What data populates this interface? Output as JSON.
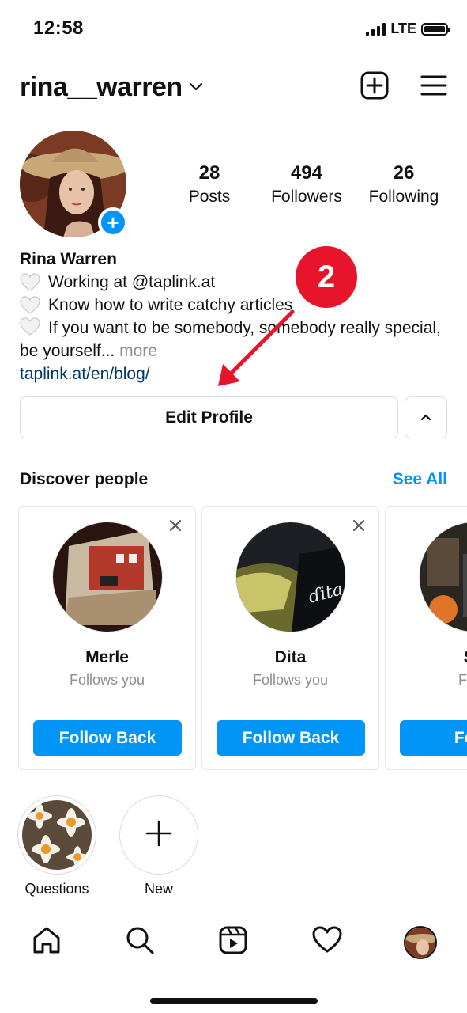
{
  "status_bar": {
    "time": "12:58",
    "network": "LTE",
    "battery_level": 0.95
  },
  "header": {
    "username": "rina__warren",
    "icons": [
      "chevron-down-icon",
      "add-post-icon",
      "menu-icon"
    ]
  },
  "profile": {
    "stats": [
      {
        "value": "28",
        "label": "Posts"
      },
      {
        "value": "494",
        "label": "Followers"
      },
      {
        "value": "26",
        "label": "Following"
      }
    ],
    "name": "Rina Warren",
    "bio_lines": [
      "Working at @taplink.at",
      "Know how to write catchy articles",
      "If you want to be somebody, somebody really special, be yourself..."
    ],
    "more": "more",
    "link": "taplink.at/en/blog/"
  },
  "annotation": {
    "number": "2",
    "color": "#e8142b"
  },
  "buttons": {
    "edit_profile": "Edit Profile"
  },
  "discover": {
    "title": "Discover people",
    "see_all": "See All",
    "cards": [
      {
        "name": "Merle",
        "subtitle": "Follows you",
        "button": "Follow Back"
      },
      {
        "name": "Dita",
        "subtitle": "Follows you",
        "button": "Follow Back"
      },
      {
        "name": "Sy",
        "subtitle": "Follo",
        "button": "Follo"
      }
    ]
  },
  "highlights": [
    {
      "label": "Questions"
    },
    {
      "label": "New"
    }
  ],
  "tabbar": {
    "items": [
      "home-icon",
      "search-icon",
      "reels-icon",
      "heart-icon",
      "profile-avatar"
    ]
  },
  "colors": {
    "accent": "#0095f6",
    "link": "#00376b",
    "muted": "#8e8e8e",
    "border": "#dbdbdb"
  }
}
